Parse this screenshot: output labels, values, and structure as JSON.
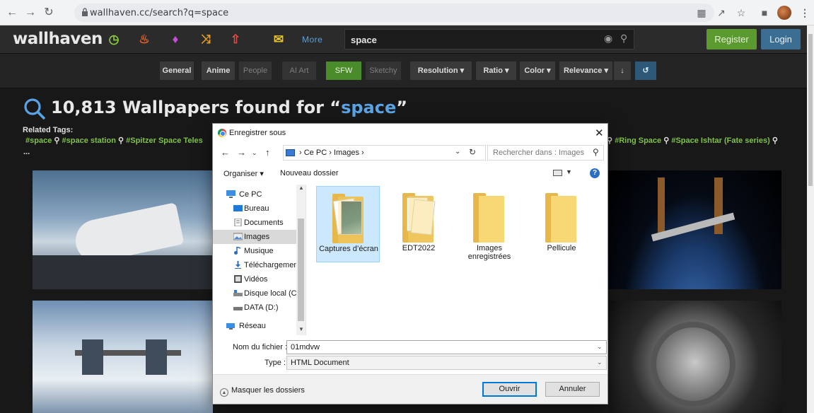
{
  "browser": {
    "url": "wallhaven.cc/search?q=space",
    "back_icon": "arrow-left-icon",
    "forward_icon": "arrow-right-icon",
    "reload_icon": "reload-icon"
  },
  "header": {
    "logo": "wallhaven",
    "more_label": "More",
    "search_value": "space",
    "register_label": "Register",
    "login_label": "Login",
    "colors": {
      "register": "#5b9a2f",
      "login": "#3c6d93",
      "accent": "#5aa4e6",
      "tag": "#7fc24a"
    }
  },
  "filters": {
    "general": "General",
    "anime": "Anime",
    "people": "People",
    "ai_art": "AI Art",
    "sfw": "SFW",
    "sketchy": "Sketchy",
    "resolution": "Resolution",
    "ratio": "Ratio",
    "color": "Color",
    "relevance": "Relevance"
  },
  "results": {
    "count_text": "10,813 Wallpapers found for “",
    "query": "space",
    "close_quote": "”",
    "related_label": "Related Tags:",
    "tags_left": [
      "#space",
      "#space station",
      "#Spitzer Space Teles"
    ],
    "tags_right": [
      "#Ring Space",
      "#Space Ishtar (Fate series)"
    ],
    "more_tags": "..."
  },
  "dialog": {
    "title": "Enregistrer sous",
    "path_pc": "Ce PC",
    "path_folder": "Images",
    "search_placeholder": "Rechercher dans : Images",
    "organize": "Organiser",
    "new_folder": "Nouveau dossier",
    "nav": [
      {
        "label": "Ce PC",
        "icon": "computer-icon"
      },
      {
        "label": "Bureau",
        "icon": "desktop-icon"
      },
      {
        "label": "Documents",
        "icon": "documents-icon"
      },
      {
        "label": "Images",
        "icon": "pictures-icon"
      },
      {
        "label": "Musique",
        "icon": "music-icon"
      },
      {
        "label": "Téléchargement",
        "icon": "download-icon"
      },
      {
        "label": "Vidéos",
        "icon": "videos-icon"
      },
      {
        "label": "Disque local (C:)",
        "icon": "drive-icon"
      },
      {
        "label": "DATA (D:)",
        "icon": "drive-icon"
      },
      {
        "label": "Réseau",
        "icon": "network-icon"
      }
    ],
    "files": [
      {
        "label": "Captures d’écran"
      },
      {
        "label": "EDT2022"
      },
      {
        "label": "Images enregistrées"
      },
      {
        "label": "Pellicule"
      }
    ],
    "filename_label": "Nom du fichier :",
    "filename_value": "01mdvw",
    "type_label": "Type :",
    "type_value": "HTML Document",
    "hide_folders": "Masquer les dossiers",
    "save": "Ouvrir",
    "cancel": "Annuler"
  }
}
